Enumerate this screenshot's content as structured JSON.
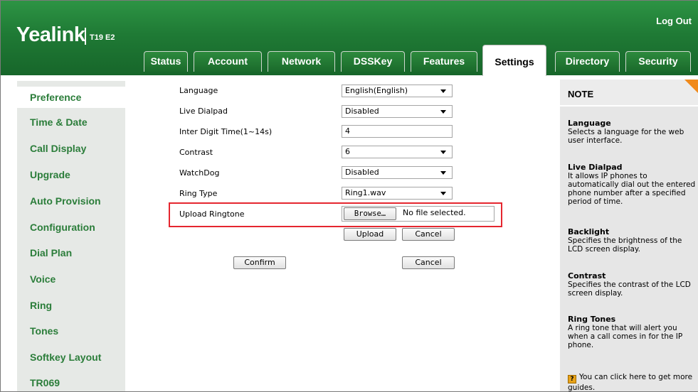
{
  "header": {
    "logo": "Yealink",
    "model": "T19 E2",
    "logout_label": "Log Out"
  },
  "tabs": [
    {
      "label": "Status"
    },
    {
      "label": "Account"
    },
    {
      "label": "Network"
    },
    {
      "label": "DSSKey"
    },
    {
      "label": "Features"
    },
    {
      "label": "Settings",
      "active": true
    },
    {
      "label": "Directory"
    },
    {
      "label": "Security"
    }
  ],
  "sidebar": {
    "items": [
      {
        "label": "Preference",
        "active": true
      },
      {
        "label": "Time & Date"
      },
      {
        "label": "Call Display"
      },
      {
        "label": "Upgrade"
      },
      {
        "label": "Auto Provision"
      },
      {
        "label": "Configuration"
      },
      {
        "label": "Dial Plan"
      },
      {
        "label": "Voice"
      },
      {
        "label": "Ring"
      },
      {
        "label": "Tones"
      },
      {
        "label": "Softkey Layout"
      },
      {
        "label": "TR069"
      }
    ]
  },
  "form": {
    "language": {
      "label": "Language",
      "value": "English(English)"
    },
    "live_dialpad": {
      "label": "Live Dialpad",
      "value": "Disabled"
    },
    "inter_digit": {
      "label": "Inter Digit Time(1~14s)",
      "value": "4"
    },
    "contrast": {
      "label": "Contrast",
      "value": "6"
    },
    "watchdog": {
      "label": "WatchDog",
      "value": "Disabled"
    },
    "ring_type": {
      "label": "Ring Type",
      "value": "Ring1.wav"
    },
    "upload_ringtone": {
      "label": "Upload Ringtone",
      "browse_label": "Browse…",
      "file_status": "No file selected."
    },
    "upload_label": "Upload",
    "upload_cancel_label": "Cancel",
    "confirm_label": "Confirm",
    "cancel_label": "Cancel"
  },
  "note": {
    "title": "NOTE",
    "sections": [
      {
        "heading": "Language",
        "text": "Selects a language for the web user interface."
      },
      {
        "heading": "Live Dialpad",
        "text": "It allows IP phones to automatically dial out the entered phone number after a specified period of time."
      },
      {
        "heading": "Backlight",
        "text": "Specifies the brightness of the LCD screen display."
      },
      {
        "heading": "Contrast",
        "text": "Specifies the contrast of the LCD screen display."
      },
      {
        "heading": "Ring Tones",
        "text": "A ring tone that will alert you when a call comes in for the IP phone."
      }
    ],
    "guide_text": "You can click here to get more guides."
  },
  "colors": {
    "header_green": "#1f7a35",
    "nav_green": "#2b7d3a",
    "highlight_red": "#e5262f",
    "note_corner": "#f08a1c"
  }
}
